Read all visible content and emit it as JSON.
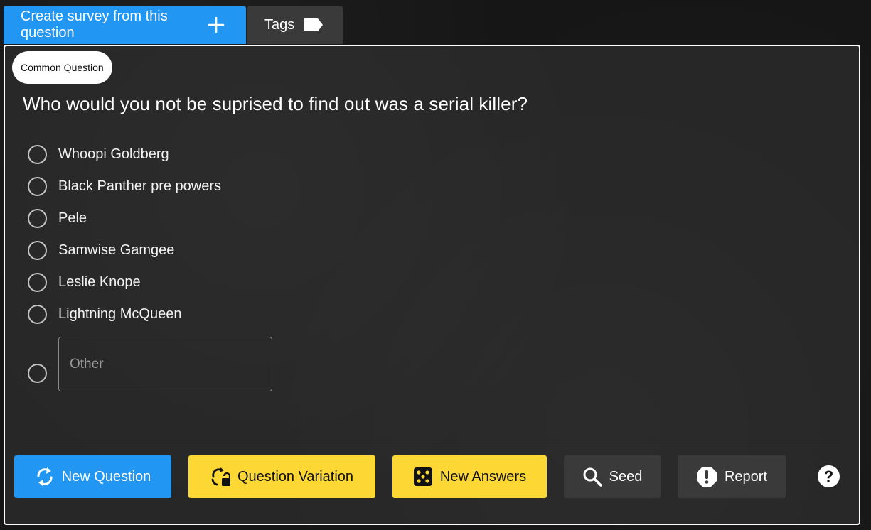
{
  "top_tabs": {
    "create_survey_label": "Create survey from this question",
    "create_survey_icon": "plus-icon",
    "tags_label": "Tags",
    "tags_icon": "tag-icon"
  },
  "card": {
    "badge": "Common Question",
    "question": "Who would you not be suprised to find out was a serial killer?",
    "options": [
      "Whoopi Goldberg",
      "Black Panther pre powers",
      "Pele",
      "Samwise Gamgee",
      "Leslie Knope",
      "Lightning McQueen"
    ],
    "other_placeholder": "Other",
    "other_value": ""
  },
  "actions": {
    "new_question": "New Question",
    "new_question_icon": "refresh-icon",
    "question_variation": "Question Variation",
    "question_variation_icon": "variation-lock-icon",
    "new_answers": "New Answers",
    "new_answers_icon": "dice-icon",
    "seed": "Seed",
    "seed_icon": "search-icon",
    "report": "Report",
    "report_icon": "warning-octagon-icon",
    "help": "?",
    "help_icon": "help-icon"
  },
  "colors": {
    "primary_blue": "#2196f3",
    "accent_yellow": "#fdd835",
    "dark_button": "#3a3a3a",
    "card_bg": "#272727",
    "page_bg": "#161616"
  }
}
